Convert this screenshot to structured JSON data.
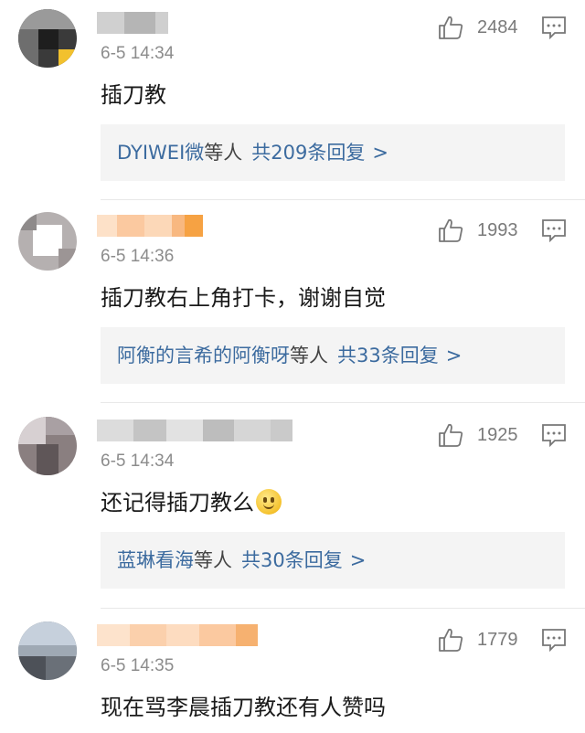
{
  "comments": [
    {
      "time": "6-5 14:34",
      "text": "插刀教",
      "likes": "2484",
      "replies": {
        "users": "DYIWEI微",
        "etc": "等人",
        "count": "共209条回复",
        "chevron": ">"
      }
    },
    {
      "time": "6-5 14:36",
      "text": "插刀教右上角打卡，谢谢自觉",
      "likes": "1993",
      "replies": {
        "users": "阿衡的言希的阿衡呀",
        "etc": "等人",
        "count": "共33条回复",
        "chevron": ">"
      }
    },
    {
      "time": "6-5 14:34",
      "text": "还记得插刀教么",
      "emoji": "smile-emoji",
      "likes": "1925",
      "replies": {
        "users": "蓝琳看海",
        "etc": "等人",
        "count": "共30条回复",
        "chevron": ">"
      }
    },
    {
      "time": "6-5 14:35",
      "text": "现在骂李晨插刀教还有人赞吗",
      "likes": "1779"
    }
  ],
  "icons": {
    "like": "thumbs-up-icon",
    "comment": "comment-icon"
  },
  "colors": {
    "link": "#3c6b9f",
    "meta": "#8c8c8c",
    "reply_bg": "#f4f4f4"
  }
}
